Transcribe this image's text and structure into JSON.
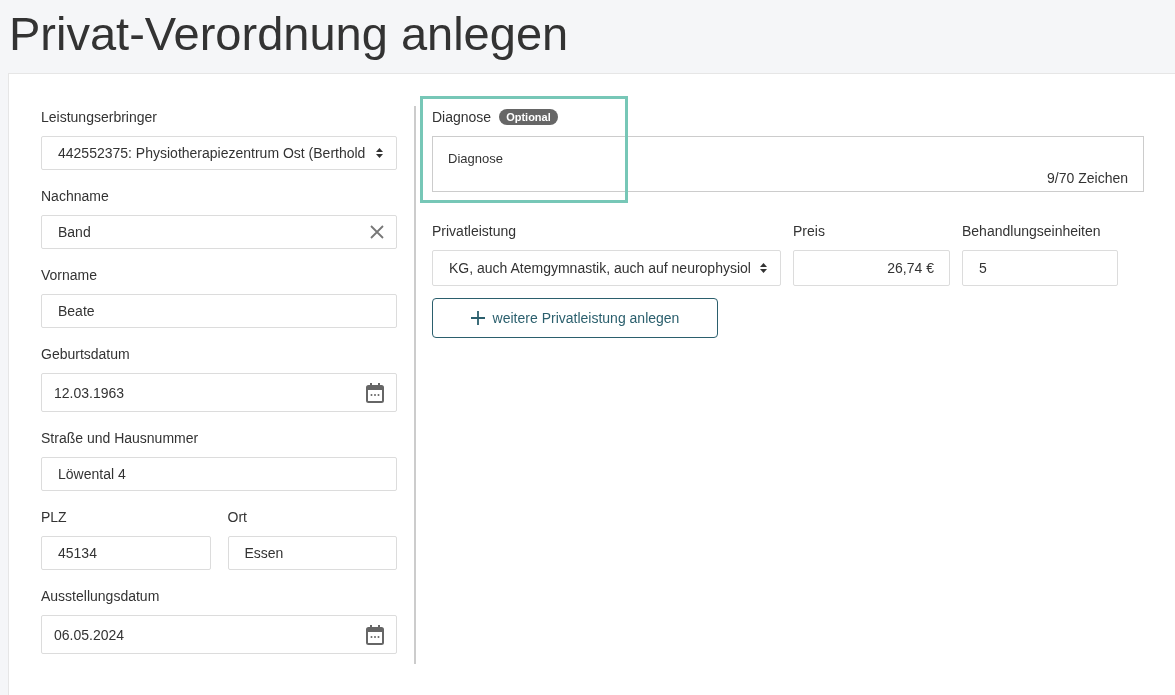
{
  "page_title": "Privat-Verordnung anlegen",
  "left_rows": [
    {
      "fields": [
        {
          "label": "Leistungserbringer",
          "value": "442552375: Physiotherapiezentrum Ost (Berthold",
          "kind": "select"
        }
      ]
    },
    {
      "fields": [
        {
          "label": "Nachname",
          "value": "Band",
          "kind": "clearable"
        }
      ]
    },
    {
      "fields": [
        {
          "label": "Vorname",
          "value": "Beate",
          "kind": "text"
        }
      ]
    },
    {
      "fields": [
        {
          "label": "Geburtsdatum",
          "value": "12.03.1963",
          "kind": "date"
        }
      ]
    },
    {
      "fields": [
        {
          "label": "Straße und Hausnummer",
          "value": "Löwental 4",
          "kind": "text"
        }
      ]
    },
    {
      "fields": [
        {
          "label": "PLZ",
          "value": "45134",
          "kind": "text"
        },
        {
          "label": "Ort",
          "value": "Essen",
          "kind": "text"
        }
      ]
    },
    {
      "fields": [
        {
          "label": "Ausstellungsdatum",
          "value": "06.05.2024",
          "kind": "date"
        }
      ]
    }
  ],
  "diagnose": {
    "label": "Diagnose",
    "badge": "Optional",
    "value": "Diagnose",
    "counter": "9/70 Zeichen",
    "highlighted": true
  },
  "service_row": [
    {
      "label": "Privatleistung",
      "value": "KG, auch Atemgymnastik, auch auf neurophysiol",
      "kind": "select"
    },
    {
      "label": "Preis",
      "value": "26,74 €",
      "kind": "price"
    },
    {
      "label": "Behandlungseinheiten",
      "value": "5",
      "kind": "text"
    }
  ],
  "add_button": {
    "label": "weitere Privatleistung anlegen"
  }
}
